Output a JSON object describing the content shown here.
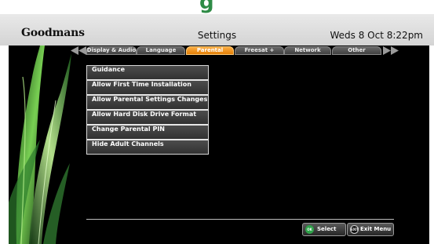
{
  "header": {
    "brand": "Goodmans",
    "title": "Settings",
    "datetime": "Weds 8 Oct  8:22pm"
  },
  "tabs": [
    {
      "label": "Display & Audio",
      "active": false
    },
    {
      "label": "Language",
      "active": false
    },
    {
      "label": "Parental",
      "active": true
    },
    {
      "label": "Freesat +",
      "active": false
    },
    {
      "label": "Network",
      "active": false
    },
    {
      "label": "Other",
      "active": false
    }
  ],
  "menu": {
    "items": [
      "Guidance",
      "Allow First Time Installation",
      "Allow Parental Settings Changes",
      "Allow Hard Disk Drive Format",
      "Change Parental PIN",
      "Hide Adult Channels"
    ]
  },
  "footer": {
    "ok_icon_label": "OK",
    "select_label": "Select",
    "exit_icon_label": "EXIT",
    "exit_label": "Exit Menu"
  },
  "colors": {
    "accent_active_tab": "#f28c00",
    "leaf_green": "#6fd04a",
    "ok_button": "#2fa34a"
  },
  "icons": {
    "tab_left": "double-left-arrow",
    "tab_right": "double-right-arrow",
    "ok_button": "ok-button-icon",
    "exit_button": "exit-button-icon",
    "decoration": "grass-leaf-decoration"
  }
}
